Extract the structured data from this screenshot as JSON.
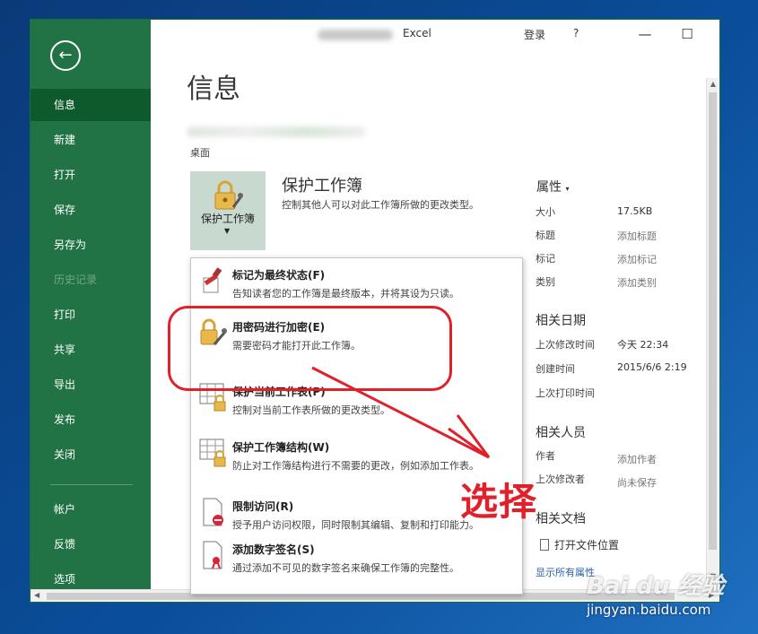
{
  "window": {
    "app_name": "Excel",
    "sign_in": "登录",
    "help": "?",
    "minimize": "—",
    "maximize": "☐",
    "close": "✕"
  },
  "sidebar": {
    "back_icon": "←",
    "items": [
      {
        "label": "信息"
      },
      {
        "label": "新建"
      },
      {
        "label": "打开"
      },
      {
        "label": "保存"
      },
      {
        "label": "另存为"
      },
      {
        "label": "历史记录"
      },
      {
        "label": "打印"
      },
      {
        "label": "共享"
      },
      {
        "label": "导出"
      },
      {
        "label": "发布"
      },
      {
        "label": "关闭"
      },
      {
        "label": "帐户"
      },
      {
        "label": "反馈"
      },
      {
        "label": "选项"
      }
    ]
  },
  "main": {
    "title": "信息",
    "file_location": "桌面",
    "protect": {
      "button_label": "保护工作簿",
      "heading": "保护工作簿",
      "description": "控制其他人可以对此工作簿所做的更改类型。"
    },
    "properties": {
      "heading": "属性",
      "rows": [
        {
          "label": "大小",
          "value": "17.5KB"
        },
        {
          "label": "标题",
          "value": "添加标题"
        },
        {
          "label": "标记",
          "value": "添加标记"
        },
        {
          "label": "类别",
          "value": "添加类别"
        }
      ]
    },
    "related_dates": {
      "heading": "相关日期",
      "rows": [
        {
          "label": "上次修改时间",
          "value": "今天 22:34"
        },
        {
          "label": "创建时间",
          "value": "2015/6/6 2:19"
        },
        {
          "label": "上次打印时间",
          "value": ""
        }
      ]
    },
    "related_people": {
      "heading": "相关人员",
      "rows": [
        {
          "label": "作者",
          "value": "添加作者"
        },
        {
          "label": "上次修改者",
          "value": "尚未保存"
        }
      ]
    },
    "related_docs": {
      "heading": "相关文档",
      "open_location": "打开文件位置"
    },
    "show_all": "显示所有属性"
  },
  "dropdown": {
    "items": [
      {
        "title": "标记为最终状态(F)",
        "description": "告知读者您的工作簿是最终版本，并将其设为只读。",
        "icon": "final-stamp-icon"
      },
      {
        "title": "用密码进行加密(E)",
        "description": "需要密码才能打开此工作簿。",
        "icon": "lock-key-icon"
      },
      {
        "title": "保护当前工作表(P)",
        "description": "控制对当前工作表所做的更改类型。",
        "icon": "sheet-lock-icon"
      },
      {
        "title": "保护工作簿结构(W)",
        "description": "防止对工作簿结构进行不需要的更改，例如添加工作表。",
        "icon": "workbook-lock-icon"
      },
      {
        "title": "限制访问(R)",
        "description": "授予用户访问权限，同时限制其编辑、复制和打印能力。",
        "icon": "restrict-access-icon"
      },
      {
        "title": "添加数字签名(S)",
        "description": "通过添加不可见的数字签名来确保工作簿的完整性。",
        "icon": "digital-signature-icon"
      }
    ]
  },
  "annotation": {
    "text": "选择",
    "color": "#e0202a"
  },
  "watermark": {
    "brand": "Bai du 经验",
    "url": "jingyan.baidu.com"
  },
  "colors": {
    "sidebar_bg": "#217346",
    "sidebar_active": "#0e5a2c",
    "accent_red": "#e0202a"
  }
}
